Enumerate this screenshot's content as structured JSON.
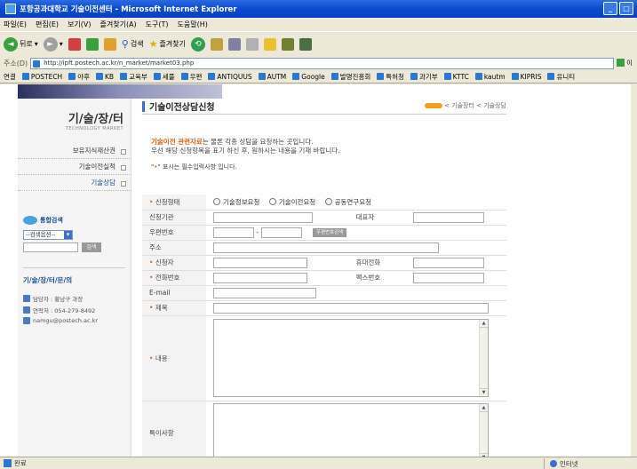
{
  "window": {
    "title": "포항공과대학교 기술이전센터 - Microsoft Internet Explorer"
  },
  "menu": [
    "파일(E)",
    "편집(E)",
    "보기(V)",
    "즐겨찾기(A)",
    "도구(T)",
    "도움말(H)"
  ],
  "toolbar": {
    "back": "뒤로",
    "search": "검색",
    "favorites": "즐겨찾기"
  },
  "address": {
    "label": "주소(D)",
    "url": "http://ipft.postech.ac.kr/n_market/market03.php",
    "go": "이"
  },
  "links": {
    "label": "연결",
    "items": [
      "POSTECH",
      "야후",
      "KB",
      "교육부",
      "세풀",
      "우편",
      "ANTIQUUS",
      "AUTM",
      "Google",
      "발명진흥회",
      "특허청",
      "과기부",
      "KTTC",
      "kautm",
      "KIPRIS",
      "유니티"
    ]
  },
  "sidebar": {
    "title": "기/술/장/터",
    "subtitle": "TECHNOLOGY MARKET",
    "menu": [
      "보유지식재산권",
      "기술이전실적",
      "기술상담"
    ],
    "search_title": "통합검색",
    "search_select": "--검색옵션--",
    "search_button": "검색",
    "contact_title": "기/술/장/터/문/의",
    "contact_person": "담당자 : 황남구 과장",
    "contact_phone": "연락처 : 054-279-8492",
    "contact_email": "namgu@postech.ac.kr"
  },
  "main": {
    "title": "기술이전상담신청",
    "breadcrumb": "< 기술장터 < 기술상담",
    "intro_highlight": "기술이전 관련자료",
    "intro_line1_rest": "는 물론 각종 상담을 요청하는 곳입니다.",
    "intro_line2": "우선 해당 신청항목을 표기 하신 후, 원하시는 내용을 기재 바랍니다.",
    "required_note_a": "\"",
    "required_note_star": "•",
    "required_note_b": "\" 표시는 필수입력사항 입니다."
  },
  "form": {
    "type_label": "신청형태",
    "type_options": [
      "기술정보요청",
      "기술이전요청",
      "공동연구요청"
    ],
    "org_label": "신청기관",
    "ceo_label": "대표자",
    "zip_label": "우편번호",
    "zip_button": "우편번호검색",
    "zip_sep": "-",
    "addr_label": "주소",
    "applicant_label": "신청자",
    "mobile_label": "휴대전화",
    "phone_label": "전화번호",
    "fax_label": "팩스번호",
    "email_label": "E-mail",
    "subject_label": "제목",
    "content_label": "내용",
    "remarks_label": "특이사항"
  },
  "status": {
    "left": "완료",
    "zone": "인터넷"
  }
}
